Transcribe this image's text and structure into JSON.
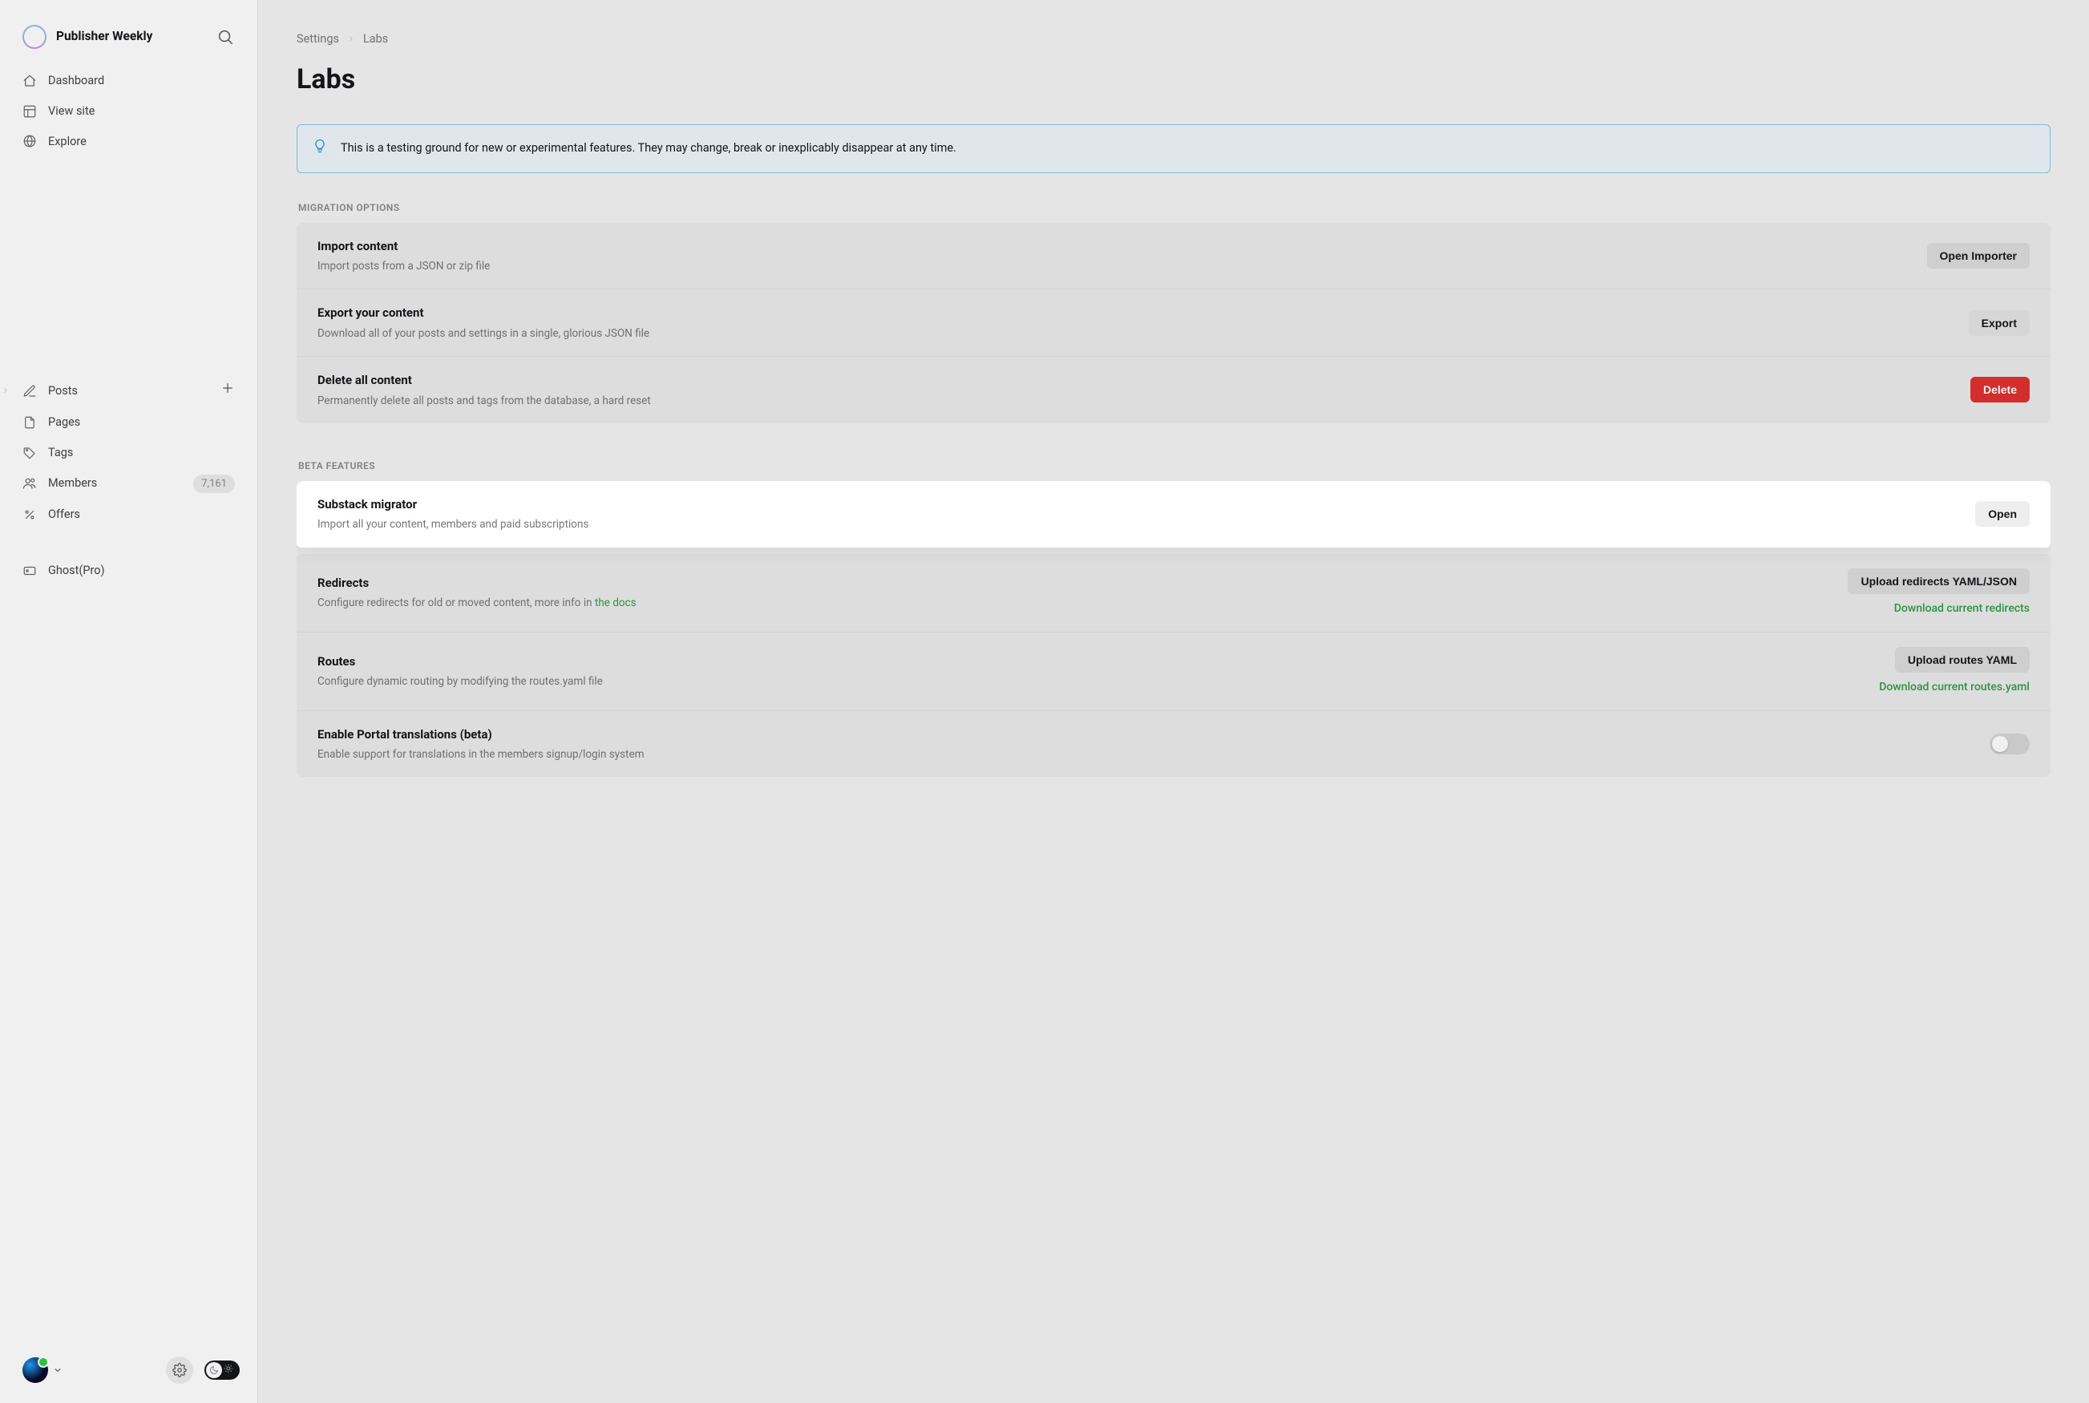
{
  "brand": {
    "name": "Publisher Weekly"
  },
  "sidebar": {
    "primary": [
      {
        "label": "Dashboard"
      },
      {
        "label": "View site"
      },
      {
        "label": "Explore"
      }
    ],
    "content": {
      "posts_label": "Posts",
      "pages_label": "Pages",
      "tags_label": "Tags",
      "members_label": "Members",
      "members_count": "7,161",
      "offers_label": "Offers",
      "ghostpro_label": "Ghost(Pro)"
    }
  },
  "breadcrumb": {
    "root": "Settings",
    "current": "Labs"
  },
  "page": {
    "title": "Labs"
  },
  "banner": {
    "text": "This is a testing ground for new or experimental features. They may change, break or inexplicably disappear at any time."
  },
  "migration": {
    "label": "MIGRATION OPTIONS",
    "import": {
      "title": "Import content",
      "sub": "Import posts from a JSON or zip file",
      "button": "Open Importer"
    },
    "export": {
      "title": "Export your content",
      "sub": "Download all of your posts and settings in a single, glorious JSON file",
      "button": "Export"
    },
    "delete": {
      "title": "Delete all content",
      "sub": "Permanently delete all posts and tags from the database, a hard reset",
      "button": "Delete"
    }
  },
  "beta": {
    "label": "BETA FEATURES",
    "substack": {
      "title": "Substack migrator",
      "sub": "Import all your content, members and paid subscriptions",
      "button": "Open"
    },
    "redirects": {
      "title": "Redirects",
      "sub_prefix": "Configure redirects for old or moved content, more info in ",
      "sub_link": "the docs",
      "button": "Upload redirects YAML/JSON",
      "download": "Download current redirects"
    },
    "routes": {
      "title": "Routes",
      "sub": "Configure dynamic routing by modifying the routes.yaml file",
      "button": "Upload routes YAML",
      "download": "Download current routes.yaml"
    },
    "portal": {
      "title": "Enable Portal translations (beta)",
      "sub": "Enable support for translations in the members signup/login system"
    }
  }
}
